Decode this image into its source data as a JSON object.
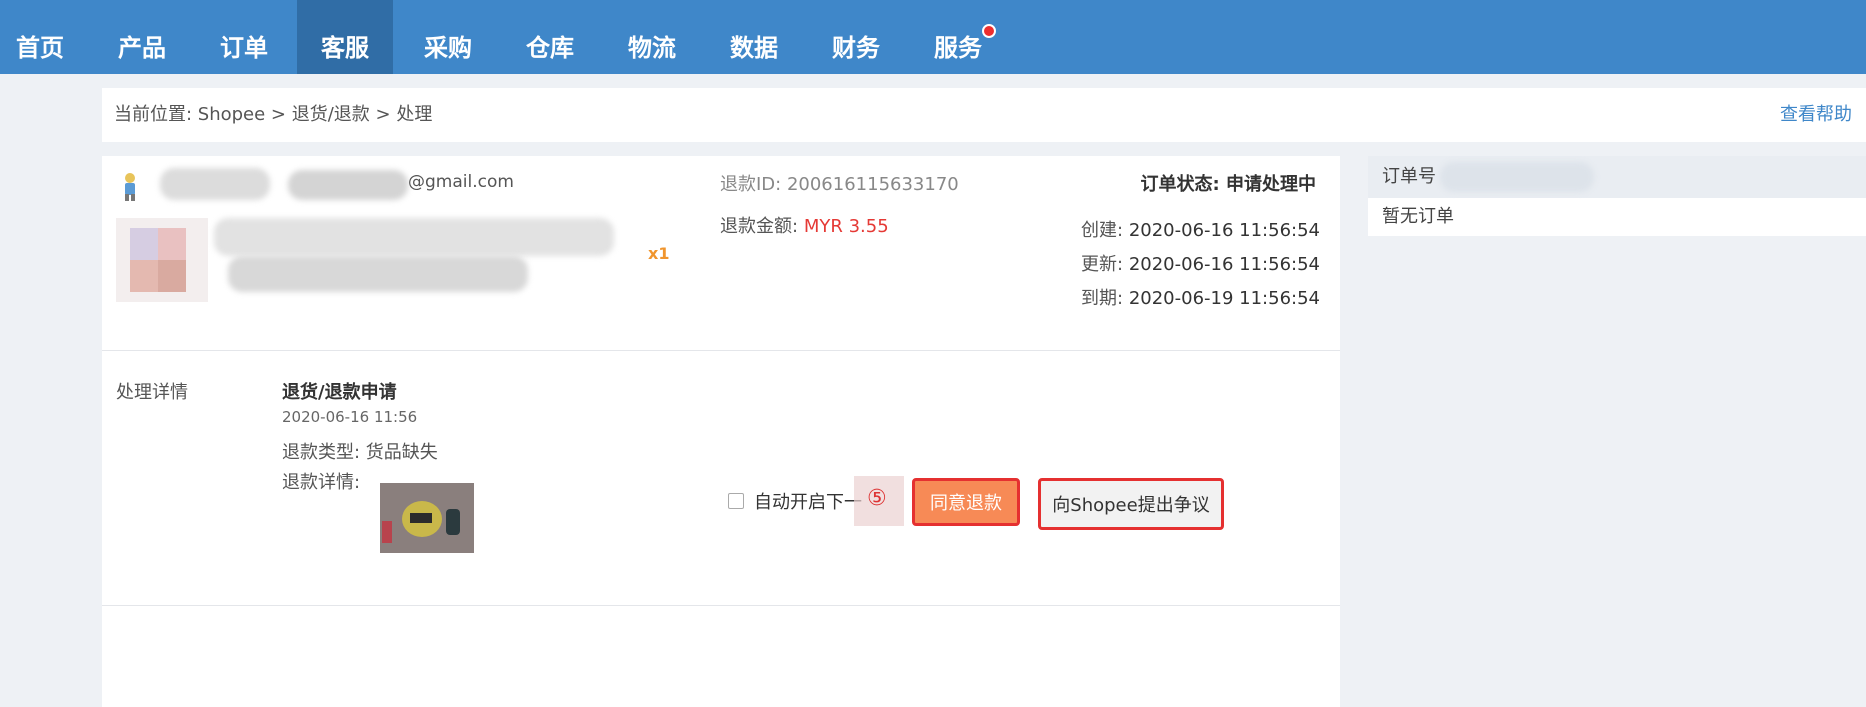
{
  "nav": {
    "items": [
      {
        "label": "首页"
      },
      {
        "label": "产品"
      },
      {
        "label": "订单"
      },
      {
        "label": "客服"
      },
      {
        "label": "采购"
      },
      {
        "label": "仓库"
      },
      {
        "label": "物流"
      },
      {
        "label": "数据"
      },
      {
        "label": "财务"
      },
      {
        "label": "服务"
      }
    ],
    "active": "客服"
  },
  "breadcrumb": {
    "text": "当前位置:  Shopee > 退货/退款 > 处理",
    "help": "查看帮助"
  },
  "order": {
    "email_suffix": "@gmail.com",
    "quantity": "x1",
    "refund_id": "退款ID:  200616115633170",
    "refund_amount_label": "退款金额:",
    "refund_amount_value": "MYR 3.55",
    "status": "订单状态:  申请处理中",
    "created_label": "创建:",
    "created_value": "2020-06-16 11:56:54",
    "updated_label": "更新:",
    "updated_value": "2020-06-16 11:56:54",
    "due_label": "到期:",
    "due_value": "2020-06-19 11:56:54"
  },
  "details": {
    "section_label": "处理详情",
    "title": "退货/退款申请",
    "date": "2020-06-16 11:56",
    "type": "退款类型:  货品缺失",
    "info_label": "退款详情:"
  },
  "actions": {
    "auto_next": "自动开启下一",
    "step_marker": "⑤",
    "agree": "同意退款",
    "dispute": "向Shopee提出争议"
  },
  "side": {
    "header": "订单号",
    "empty": "暂无订单"
  },
  "colors": {
    "nav_bg": "#3f87c9",
    "nav_active": "#306da6",
    "amount": "#e53935",
    "agree_btn": "#f78a56",
    "highlight_border": "#e53030"
  }
}
